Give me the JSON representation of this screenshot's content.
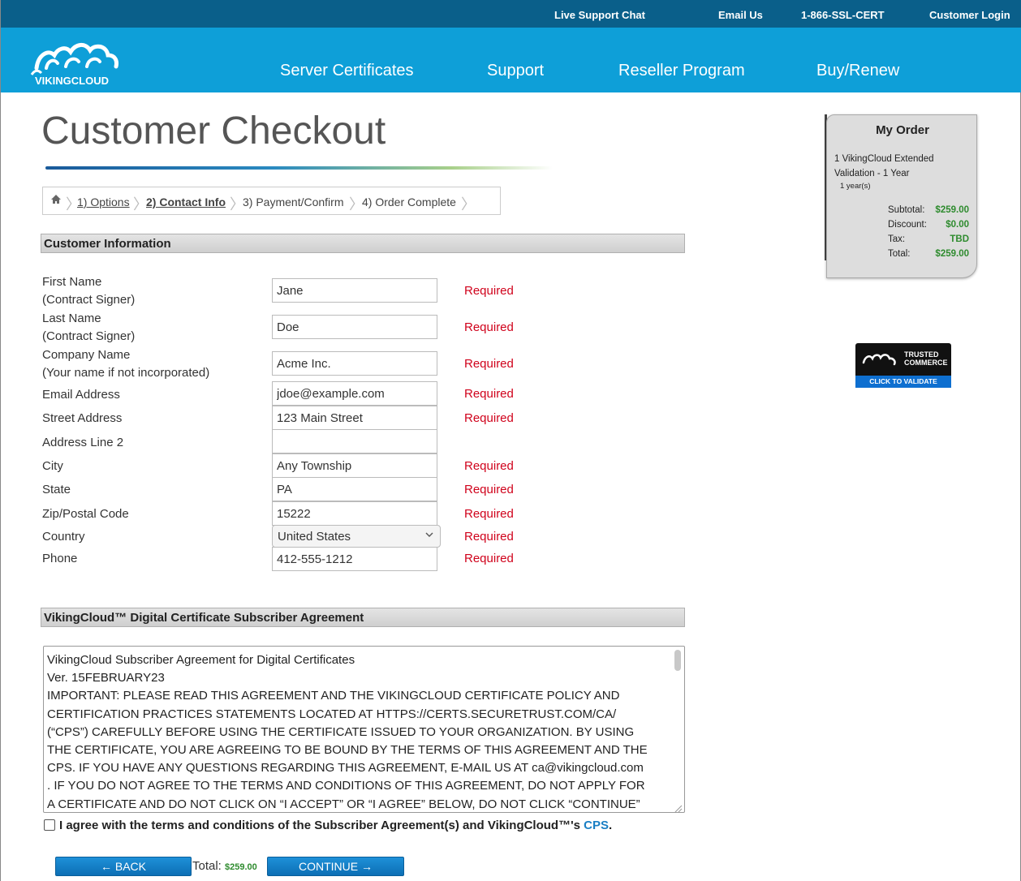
{
  "topbar": {
    "live_chat": "Live Support Chat",
    "email_us": "Email Us",
    "phone": "1-866-SSL-CERT",
    "customer_login": "Customer Login"
  },
  "brand": {
    "logo_text": "VIKINGCLOUD"
  },
  "nav": {
    "server_certificates": "Server Certificates",
    "support": "Support",
    "reseller_program": "Reseller Program",
    "buy_renew": "Buy/Renew"
  },
  "page": {
    "title": "Customer Checkout"
  },
  "steps": {
    "options": "1) Options",
    "contact_info": "2) Contact Info",
    "payment_confirm": "3) Payment/Confirm",
    "order_complete": "4) Order Complete"
  },
  "customer_info": {
    "header": "Customer Information",
    "required_text": "Required",
    "fields": {
      "first_name": {
        "label1": "First Name",
        "label2": "(Contract Signer)",
        "value": "Jane"
      },
      "last_name": {
        "label1": "Last Name",
        "label2": "(Contract Signer)",
        "value": "Doe"
      },
      "company": {
        "label1": "Company Name",
        "label2": "(Your name if not incorporated)",
        "value": "Acme Inc."
      },
      "email": {
        "label": "Email Address",
        "value": "jdoe@example.com"
      },
      "street": {
        "label": "Street Address",
        "value": "123 Main Street"
      },
      "address2": {
        "label": "Address Line 2",
        "value": ""
      },
      "city": {
        "label": "City",
        "value": "Any Township"
      },
      "state": {
        "label": "State",
        "value": "PA"
      },
      "zip": {
        "label": "Zip/Postal Code",
        "value": "15222"
      },
      "country": {
        "label": "Country",
        "value": "United States"
      },
      "phone": {
        "label": "Phone",
        "value": "412-555-1212"
      }
    }
  },
  "agreement": {
    "header": "VikingCloud™ Digital Certificate Subscriber Agreement",
    "lines": [
      "VikingCloud Subscriber Agreement for Digital Certificates",
      "Ver. 15FEBRUARY23",
      "IMPORTANT:  PLEASE READ THIS AGREEMENT AND THE VIKINGCLOUD CERTIFICATE POLICY AND",
      "CERTIFICATION PRACTICES STATEMENTS LOCATED AT HTTPS://CERTS.SECURETRUST.COM/CA/",
      "(“CPS”) CAREFULLY BEFORE USING THE CERTIFICATE ISSUED TO YOUR ORGANIZATION. BY USING",
      "THE CERTIFICATE, YOU ARE AGREEING TO BE BOUND BY THE TERMS OF THIS AGREEMENT AND THE",
      "CPS. IF YOU HAVE ANY QUESTIONS REGARDING THIS AGREEMENT, E-MAIL US AT ca@vikingcloud.com",
      ". IF YOU DO NOT AGREE TO THE TERMS AND CONDITIONS OF THIS AGREEMENT, DO NOT APPLY FOR",
      "A CERTIFICATE AND DO NOT CLICK ON “I ACCEPT” OR “I AGREE” BELOW, DO NOT CLICK “CONTINUE”"
    ],
    "agree_text": "I agree with the terms and conditions of the Subscriber Agreement(s) and VikingCloud™'s",
    "cps_link": "CPS",
    "period": "."
  },
  "footer": {
    "back": "← BACK",
    "total_label": "Total:",
    "total_value": "$259.00",
    "continue": "CONTINUE →"
  },
  "order": {
    "title": "My Order",
    "item_line1": "1 VikingCloud Extended",
    "item_line2": "Validation - 1 Year",
    "qty": "1 year(s)",
    "subtotal_label": "Subtotal:",
    "subtotal_value": "$259.00",
    "discount_label": "Discount:",
    "discount_value": "$0.00",
    "tax_label": "Tax:",
    "tax_value": "TBD",
    "total_label": "Total:",
    "total_value": "$259.00"
  },
  "badge": {
    "line1": "TRUSTED",
    "line2": "COMMERCE",
    "cta": "CLICK TO VALIDATE"
  }
}
